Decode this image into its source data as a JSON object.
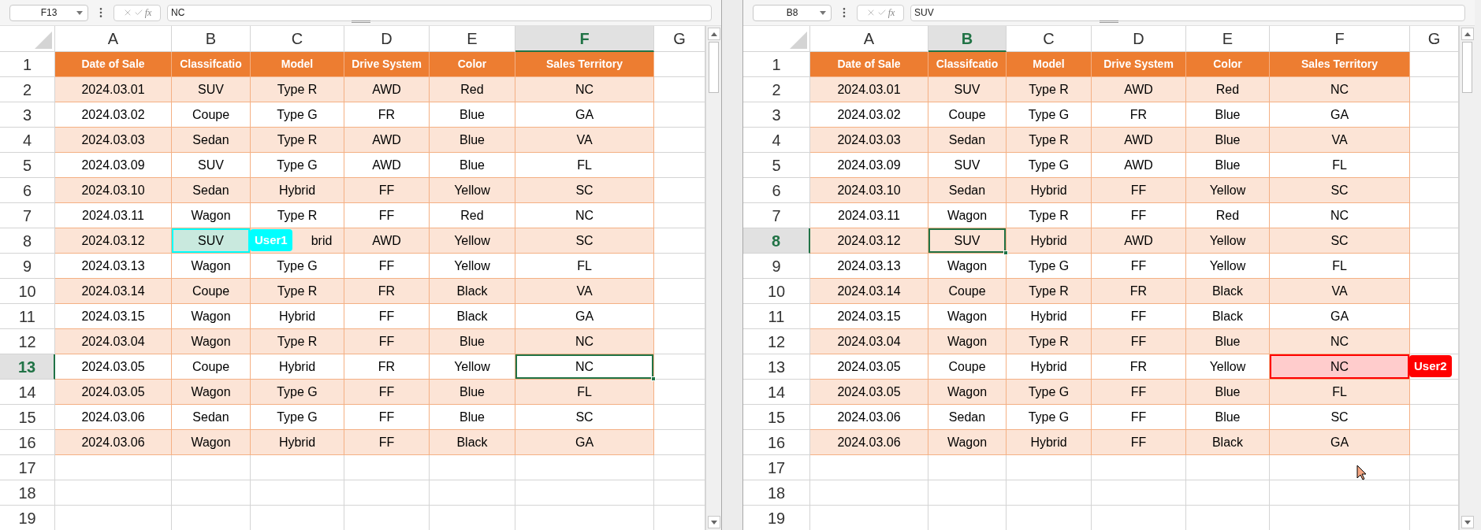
{
  "panes": [
    {
      "name_box": "F13",
      "function_label": "fx",
      "formula": "NC",
      "columns": [
        {
          "label": "A",
          "selected": false
        },
        {
          "label": "B",
          "selected": false
        },
        {
          "label": "C",
          "selected": false
        },
        {
          "label": "D",
          "selected": false
        },
        {
          "label": "E",
          "selected": false
        },
        {
          "label": "F",
          "selected": true
        },
        {
          "label": "G",
          "selected": false
        }
      ],
      "rows": [
        {
          "label": "1",
          "selected": false,
          "kind": "header",
          "cells": [
            {
              "text": "Date of Sale",
              "selected": false
            },
            {
              "text": "Classifcatio",
              "selected": false
            },
            {
              "text": "Model",
              "selected": false
            },
            {
              "text": "Drive System",
              "selected": false
            },
            {
              "text": "Color",
              "selected": false
            },
            {
              "text": "Sales Territory",
              "selected": false
            }
          ]
        },
        {
          "label": "2",
          "selected": false,
          "kind": "band",
          "cells": [
            {
              "text": "2024.03.01",
              "selected": false
            },
            {
              "text": "SUV",
              "selected": false
            },
            {
              "text": "Type R",
              "selected": false
            },
            {
              "text": "AWD",
              "selected": false
            },
            {
              "text": "Red",
              "selected": false
            },
            {
              "text": "NC",
              "selected": false
            }
          ]
        },
        {
          "label": "3",
          "selected": false,
          "kind": "plain",
          "cells": [
            {
              "text": "2024.03.02",
              "selected": false
            },
            {
              "text": "Coupe",
              "selected": false
            },
            {
              "text": "Type G",
              "selected": false
            },
            {
              "text": "FR",
              "selected": false
            },
            {
              "text": "Blue",
              "selected": false
            },
            {
              "text": "GA",
              "selected": false
            }
          ]
        },
        {
          "label": "4",
          "selected": false,
          "kind": "band",
          "cells": [
            {
              "text": "2024.03.03",
              "selected": false
            },
            {
              "text": "Sedan",
              "selected": false
            },
            {
              "text": "Type R",
              "selected": false
            },
            {
              "text": "AWD",
              "selected": false
            },
            {
              "text": "Blue",
              "selected": false
            },
            {
              "text": "VA",
              "selected": false
            }
          ]
        },
        {
          "label": "5",
          "selected": false,
          "kind": "plain",
          "cells": [
            {
              "text": "2024.03.09",
              "selected": false
            },
            {
              "text": "SUV",
              "selected": false
            },
            {
              "text": "Type G",
              "selected": false
            },
            {
              "text": "AWD",
              "selected": false
            },
            {
              "text": "Blue",
              "selected": false
            },
            {
              "text": "FL",
              "selected": false
            }
          ]
        },
        {
          "label": "6",
          "selected": false,
          "kind": "band",
          "cells": [
            {
              "text": "2024.03.10",
              "selected": false
            },
            {
              "text": "Sedan",
              "selected": false
            },
            {
              "text": "Hybrid",
              "selected": false
            },
            {
              "text": "FF",
              "selected": false
            },
            {
              "text": "Yellow",
              "selected": false
            },
            {
              "text": "SC",
              "selected": false
            }
          ]
        },
        {
          "label": "7",
          "selected": false,
          "kind": "plain",
          "cells": [
            {
              "text": "2024.03.11",
              "selected": false
            },
            {
              "text": "Wagon",
              "selected": false
            },
            {
              "text": "Type R",
              "selected": false
            },
            {
              "text": "FF",
              "selected": false
            },
            {
              "text": "Red",
              "selected": false
            },
            {
              "text": "NC",
              "selected": false
            }
          ]
        },
        {
          "label": "8",
          "selected": false,
          "kind": "band",
          "cells": [
            {
              "text": "2024.03.12",
              "selected": false
            },
            {
              "text": "SUV",
              "selected": false,
              "editor": {
                "name": "User1",
                "color": "#00ffff"
              }
            },
            {
              "text": "brid",
              "selected": false
            },
            {
              "text": "AWD",
              "selected": false
            },
            {
              "text": "Yellow",
              "selected": false
            },
            {
              "text": "SC",
              "selected": false
            }
          ]
        },
        {
          "label": "9",
          "selected": false,
          "kind": "plain",
          "cells": [
            {
              "text": "2024.03.13",
              "selected": false
            },
            {
              "text": "Wagon",
              "selected": false
            },
            {
              "text": "Type G",
              "selected": false
            },
            {
              "text": "FF",
              "selected": false
            },
            {
              "text": "Yellow",
              "selected": false
            },
            {
              "text": "FL",
              "selected": false
            }
          ]
        },
        {
          "label": "10",
          "selected": false,
          "kind": "band",
          "cells": [
            {
              "text": "2024.03.14",
              "selected": false
            },
            {
              "text": "Coupe",
              "selected": false
            },
            {
              "text": "Type R",
              "selected": false
            },
            {
              "text": "FR",
              "selected": false
            },
            {
              "text": "Black",
              "selected": false
            },
            {
              "text": "VA",
              "selected": false
            }
          ]
        },
        {
          "label": "11",
          "selected": false,
          "kind": "plain",
          "cells": [
            {
              "text": "2024.03.15",
              "selected": false
            },
            {
              "text": "Wagon",
              "selected": false
            },
            {
              "text": "Hybrid",
              "selected": false
            },
            {
              "text": "FF",
              "selected": false
            },
            {
              "text": "Black",
              "selected": false
            },
            {
              "text": "GA",
              "selected": false
            }
          ]
        },
        {
          "label": "12",
          "selected": false,
          "kind": "band",
          "cells": [
            {
              "text": "2024.03.04",
              "selected": false
            },
            {
              "text": "Wagon",
              "selected": false
            },
            {
              "text": "Type R",
              "selected": false
            },
            {
              "text": "FF",
              "selected": false
            },
            {
              "text": "Blue",
              "selected": false
            },
            {
              "text": "NC",
              "selected": false
            }
          ]
        },
        {
          "label": "13",
          "selected": true,
          "kind": "plain",
          "cells": [
            {
              "text": "2024.03.05",
              "selected": false
            },
            {
              "text": "Coupe",
              "selected": false
            },
            {
              "text": "Hybrid",
              "selected": false
            },
            {
              "text": "FR",
              "selected": false
            },
            {
              "text": "Yellow",
              "selected": false
            },
            {
              "text": "NC",
              "selected": true
            }
          ]
        },
        {
          "label": "14",
          "selected": false,
          "kind": "band",
          "cells": [
            {
              "text": "2024.03.05",
              "selected": false
            },
            {
              "text": "Wagon",
              "selected": false
            },
            {
              "text": "Type G",
              "selected": false
            },
            {
              "text": "FF",
              "selected": false
            },
            {
              "text": "Blue",
              "selected": false
            },
            {
              "text": "FL",
              "selected": false
            }
          ]
        },
        {
          "label": "15",
          "selected": false,
          "kind": "plain",
          "cells": [
            {
              "text": "2024.03.06",
              "selected": false
            },
            {
              "text": "Sedan",
              "selected": false
            },
            {
              "text": "Type G",
              "selected": false
            },
            {
              "text": "FF",
              "selected": false
            },
            {
              "text": "Blue",
              "selected": false
            },
            {
              "text": "SC",
              "selected": false
            }
          ]
        },
        {
          "label": "16",
          "selected": false,
          "kind": "band",
          "cells": [
            {
              "text": "2024.03.06",
              "selected": false
            },
            {
              "text": "Wagon",
              "selected": false
            },
            {
              "text": "Hybrid",
              "selected": false
            },
            {
              "text": "FF",
              "selected": false
            },
            {
              "text": "Black",
              "selected": false
            },
            {
              "text": "GA",
              "selected": false
            }
          ]
        },
        {
          "label": "17",
          "selected": false,
          "kind": "empty"
        },
        {
          "label": "18",
          "selected": false,
          "kind": "empty"
        },
        {
          "label": "19",
          "selected": false,
          "kind": "empty"
        }
      ]
    },
    {
      "name_box": "B8",
      "function_label": "fx",
      "formula": "SUV",
      "pointer": true,
      "columns": [
        {
          "label": "A",
          "selected": false
        },
        {
          "label": "B",
          "selected": true
        },
        {
          "label": "C",
          "selected": false
        },
        {
          "label": "D",
          "selected": false
        },
        {
          "label": "E",
          "selected": false
        },
        {
          "label": "F",
          "selected": false
        },
        {
          "label": "G",
          "selected": false
        }
      ],
      "rows": [
        {
          "label": "1",
          "selected": false,
          "kind": "header",
          "cells": [
            {
              "text": "Date of Sale",
              "selected": false
            },
            {
              "text": "Classifcatio",
              "selected": false
            },
            {
              "text": "Model",
              "selected": false
            },
            {
              "text": "Drive System",
              "selected": false
            },
            {
              "text": "Color",
              "selected": false
            },
            {
              "text": "Sales Territory",
              "selected": false
            }
          ]
        },
        {
          "label": "2",
          "selected": false,
          "kind": "band",
          "cells": [
            {
              "text": "2024.03.01",
              "selected": false
            },
            {
              "text": "SUV",
              "selected": false
            },
            {
              "text": "Type R",
              "selected": false
            },
            {
              "text": "AWD",
              "selected": false
            },
            {
              "text": "Red",
              "selected": false
            },
            {
              "text": "NC",
              "selected": false
            }
          ]
        },
        {
          "label": "3",
          "selected": false,
          "kind": "plain",
          "cells": [
            {
              "text": "2024.03.02",
              "selected": false
            },
            {
              "text": "Coupe",
              "selected": false
            },
            {
              "text": "Type G",
              "selected": false
            },
            {
              "text": "FR",
              "selected": false
            },
            {
              "text": "Blue",
              "selected": false
            },
            {
              "text": "GA",
              "selected": false
            }
          ]
        },
        {
          "label": "4",
          "selected": false,
          "kind": "band",
          "cells": [
            {
              "text": "2024.03.03",
              "selected": false
            },
            {
              "text": "Sedan",
              "selected": false
            },
            {
              "text": "Type R",
              "selected": false
            },
            {
              "text": "AWD",
              "selected": false
            },
            {
              "text": "Blue",
              "selected": false
            },
            {
              "text": "VA",
              "selected": false
            }
          ]
        },
        {
          "label": "5",
          "selected": false,
          "kind": "plain",
          "cells": [
            {
              "text": "2024.03.09",
              "selected": false
            },
            {
              "text": "SUV",
              "selected": false
            },
            {
              "text": "Type G",
              "selected": false
            },
            {
              "text": "AWD",
              "selected": false
            },
            {
              "text": "Blue",
              "selected": false
            },
            {
              "text": "FL",
              "selected": false
            }
          ]
        },
        {
          "label": "6",
          "selected": false,
          "kind": "band",
          "cells": [
            {
              "text": "2024.03.10",
              "selected": false
            },
            {
              "text": "Sedan",
              "selected": false
            },
            {
              "text": "Hybrid",
              "selected": false
            },
            {
              "text": "FF",
              "selected": false
            },
            {
              "text": "Yellow",
              "selected": false
            },
            {
              "text": "SC",
              "selected": false
            }
          ]
        },
        {
          "label": "7",
          "selected": false,
          "kind": "plain",
          "cells": [
            {
              "text": "2024.03.11",
              "selected": false
            },
            {
              "text": "Wagon",
              "selected": false
            },
            {
              "text": "Type R",
              "selected": false
            },
            {
              "text": "FF",
              "selected": false
            },
            {
              "text": "Red",
              "selected": false
            },
            {
              "text": "NC",
              "selected": false
            }
          ]
        },
        {
          "label": "8",
          "selected": true,
          "kind": "band",
          "cells": [
            {
              "text": "2024.03.12",
              "selected": false
            },
            {
              "text": "SUV",
              "selected": true
            },
            {
              "text": "Hybrid",
              "selected": false
            },
            {
              "text": "AWD",
              "selected": false
            },
            {
              "text": "Yellow",
              "selected": false
            },
            {
              "text": "SC",
              "selected": false
            }
          ]
        },
        {
          "label": "9",
          "selected": false,
          "kind": "plain",
          "cells": [
            {
              "text": "2024.03.13",
              "selected": false
            },
            {
              "text": "Wagon",
              "selected": false
            },
            {
              "text": "Type G",
              "selected": false
            },
            {
              "text": "FF",
              "selected": false
            },
            {
              "text": "Yellow",
              "selected": false
            },
            {
              "text": "FL",
              "selected": false
            }
          ]
        },
        {
          "label": "10",
          "selected": false,
          "kind": "band",
          "cells": [
            {
              "text": "2024.03.14",
              "selected": false
            },
            {
              "text": "Coupe",
              "selected": false
            },
            {
              "text": "Type R",
              "selected": false
            },
            {
              "text": "FR",
              "selected": false
            },
            {
              "text": "Black",
              "selected": false
            },
            {
              "text": "VA",
              "selected": false
            }
          ]
        },
        {
          "label": "11",
          "selected": false,
          "kind": "plain",
          "cells": [
            {
              "text": "2024.03.15",
              "selected": false
            },
            {
              "text": "Wagon",
              "selected": false
            },
            {
              "text": "Hybrid",
              "selected": false
            },
            {
              "text": "FF",
              "selected": false
            },
            {
              "text": "Black",
              "selected": false
            },
            {
              "text": "GA",
              "selected": false
            }
          ]
        },
        {
          "label": "12",
          "selected": false,
          "kind": "band",
          "cells": [
            {
              "text": "2024.03.04",
              "selected": false
            },
            {
              "text": "Wagon",
              "selected": false
            },
            {
              "text": "Type R",
              "selected": false
            },
            {
              "text": "FF",
              "selected": false
            },
            {
              "text": "Blue",
              "selected": false
            },
            {
              "text": "NC",
              "selected": false
            }
          ]
        },
        {
          "label": "13",
          "selected": false,
          "kind": "plain",
          "cells": [
            {
              "text": "2024.03.05",
              "selected": false
            },
            {
              "text": "Coupe",
              "selected": false
            },
            {
              "text": "Hybrid",
              "selected": false
            },
            {
              "text": "FR",
              "selected": false
            },
            {
              "text": "Yellow",
              "selected": false
            },
            {
              "text": "NC",
              "selected": false,
              "editor": {
                "name": "User2",
                "color": "#ff0000"
              }
            }
          ]
        },
        {
          "label": "14",
          "selected": false,
          "kind": "band",
          "cells": [
            {
              "text": "2024.03.05",
              "selected": false
            },
            {
              "text": "Wagon",
              "selected": false
            },
            {
              "text": "Type G",
              "selected": false
            },
            {
              "text": "FF",
              "selected": false
            },
            {
              "text": "Blue",
              "selected": false
            },
            {
              "text": "FL",
              "selected": false
            }
          ]
        },
        {
          "label": "15",
          "selected": false,
          "kind": "plain",
          "cells": [
            {
              "text": "2024.03.06",
              "selected": false
            },
            {
              "text": "Sedan",
              "selected": false
            },
            {
              "text": "Type G",
              "selected": false
            },
            {
              "text": "FF",
              "selected": false
            },
            {
              "text": "Blue",
              "selected": false
            },
            {
              "text": "SC",
              "selected": false
            }
          ]
        },
        {
          "label": "16",
          "selected": false,
          "kind": "band",
          "cells": [
            {
              "text": "2024.03.06",
              "selected": false
            },
            {
              "text": "Wagon",
              "selected": false
            },
            {
              "text": "Hybrid",
              "selected": false
            },
            {
              "text": "FF",
              "selected": false
            },
            {
              "text": "Black",
              "selected": false
            },
            {
              "text": "GA",
              "selected": false
            }
          ]
        },
        {
          "label": "17",
          "selected": false,
          "kind": "empty"
        },
        {
          "label": "18",
          "selected": false,
          "kind": "empty"
        },
        {
          "label": "19",
          "selected": false,
          "kind": "empty"
        }
      ]
    }
  ]
}
